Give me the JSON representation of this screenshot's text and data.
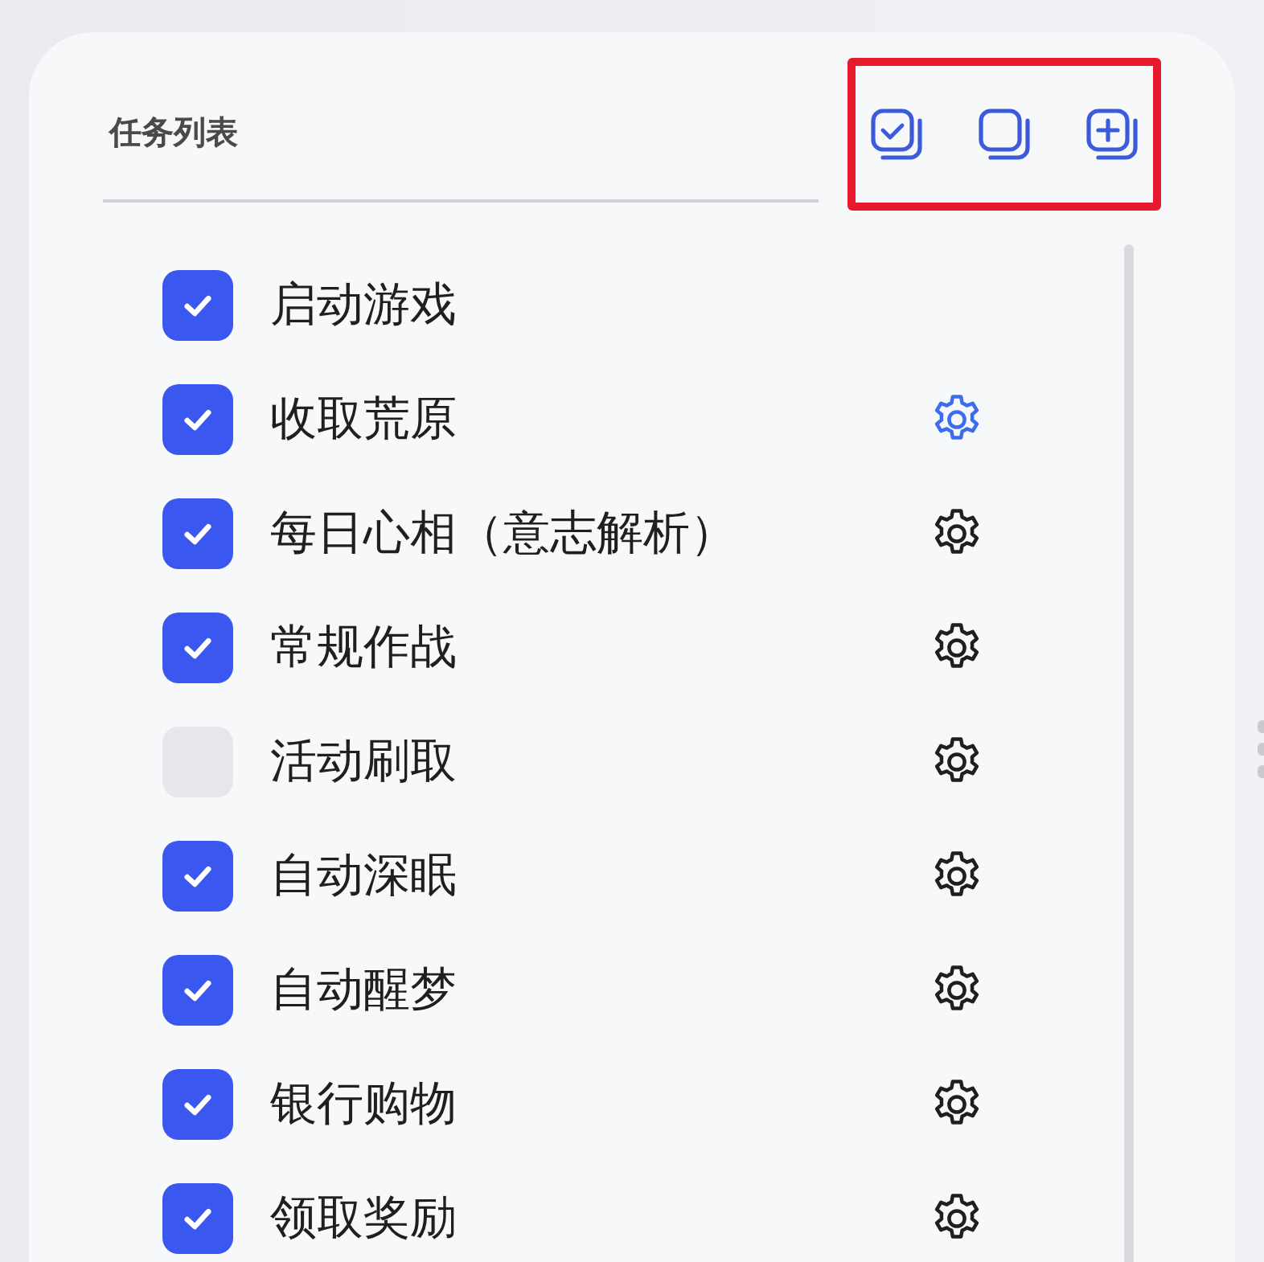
{
  "panel": {
    "title": "任务列表"
  },
  "toolbar": {
    "highlighted": true
  },
  "tasks": [
    {
      "label": "启动游戏",
      "checked": true,
      "kind": "plain"
    },
    {
      "label": "收取荒原",
      "checked": true,
      "kind": "settings",
      "selected": true
    },
    {
      "label": "每日心相（意志解析）",
      "checked": true,
      "kind": "settings",
      "selected": false
    },
    {
      "label": "常规作战",
      "checked": true,
      "kind": "settings",
      "selected": false
    },
    {
      "label": "活动刷取",
      "checked": false,
      "kind": "settings",
      "selected": false
    },
    {
      "label": "自动深眠",
      "checked": true,
      "kind": "settings",
      "selected": false
    },
    {
      "label": "自动醒梦",
      "checked": true,
      "kind": "settings",
      "selected": false
    },
    {
      "label": "银行购物",
      "checked": true,
      "kind": "settings",
      "selected": false
    },
    {
      "label": "领取奖励",
      "checked": true,
      "kind": "settings",
      "selected": false
    }
  ]
}
